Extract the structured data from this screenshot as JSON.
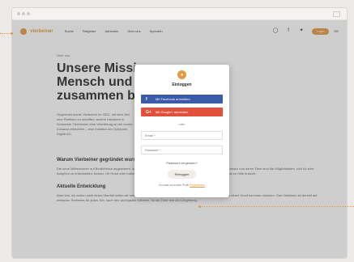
{
  "nav": {
    "logo_text": "vierbeiner",
    "links": [
      "Suche",
      "Ratgeber",
      "Adressen",
      "Über uns",
      "Spenden"
    ],
    "cta_label": "Login",
    "lang_label": "DE"
  },
  "page": {
    "crumb": "Über uns",
    "hero": "Unsere Mission: Mensch und Tier zusammen bringen",
    "intro": "Gegründet wurde Vierbeiner im 2022, mit dem Ziel, eine Plattform zu schaffen, welche Haustiere in Schweizer Tierheimen eine Vermittlung an ein neues Zuhause erleichtert – eine Initiative der Goldpoint Digital AG.",
    "section1_title": "Warum Vierbeiner gegründet wurde",
    "section1_text": "Die neue Mitbewohner auf Bedürfnisse abgestimmt, ist nicht einfach. Mit der richtigen Übersicht über Tierheime in der Schweiz und deren Tiere sind die Möglichkeiten, sich für eine Adoption zu entscheiden, besser. Ob Hund oder Katze, jedes Tier verdient ein liebevolles Zuhause, und ich bin dafür, dass es Hilfe braucht.",
    "section2_title": "Aktuelle Entwicklung",
    "section2_text": "Aber klar, wir wollen nicht einen Überfall sollen wir sehr überlegen, ob wir ein langfristig da sein Natur die zu Ihr unter uns einen Hund kommen möchten. Das Verfahren ist derzeit auf einfacher Sortiertes für jedes Tier, nach den wichtigsten Kriterien, für die Tiere aus der Umgebung."
  },
  "modal": {
    "title": "Einloggen",
    "facebook_label": "Mit Facebook anmelden",
    "google_label": "Mit Google+ anmelden",
    "or_label": "oder",
    "email_placeholder": "Email *",
    "password_placeholder": "Passwort *",
    "forgot_label": "Passwort vergessen?",
    "login_label": "Einloggen",
    "register_prefix": "Du hast noch kein Profil",
    "register_link": "Registrieren"
  },
  "colors": {
    "accent": "#e49a42",
    "facebook": "#3b5aa8",
    "google": "#e0503a"
  }
}
